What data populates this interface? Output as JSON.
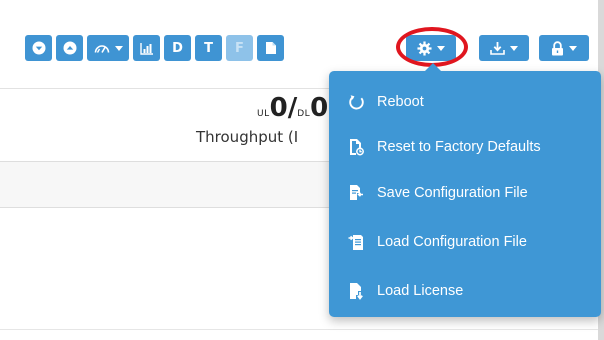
{
  "toolbar": {
    "buttons": [
      {
        "name": "down-circle-button",
        "icon": "chevron-down-circle-icon"
      },
      {
        "name": "up-circle-button",
        "icon": "chevron-up-circle-icon"
      },
      {
        "name": "speedometer-dropdown-button",
        "icon": "speedometer-icon"
      },
      {
        "name": "bar-chart-button",
        "icon": "bar-chart-icon"
      },
      {
        "name": "d-button",
        "label": "D"
      },
      {
        "name": "t-button",
        "label": "T"
      },
      {
        "name": "f-button",
        "label": "F"
      },
      {
        "name": "file-button",
        "icon": "file-icon"
      },
      {
        "name": "settings-dropdown-button",
        "icon": "gear-icon"
      },
      {
        "name": "download-dropdown-button",
        "icon": "download-icon"
      },
      {
        "name": "lock-dropdown-button",
        "icon": "lock-icon"
      }
    ],
    "accent_color": "#3f94d3",
    "highlight_color": "#e0161f"
  },
  "status": {
    "ul_label": "UL",
    "ul_value": "0/",
    "dl_label": "DL",
    "dl_value": "0",
    "throughput_label": "Throughput (I"
  },
  "settings_menu": {
    "background": "#3f97d5",
    "items": [
      {
        "label": "Reboot",
        "icon": "refresh-icon"
      },
      {
        "label": "Reset to Factory Defaults",
        "icon": "file-reset-icon"
      },
      {
        "label": "Save Configuration File",
        "icon": "file-save-icon"
      },
      {
        "label": "Load Configuration File",
        "icon": "file-load-icon"
      },
      {
        "label": "Load License",
        "icon": "file-download-icon"
      }
    ]
  }
}
